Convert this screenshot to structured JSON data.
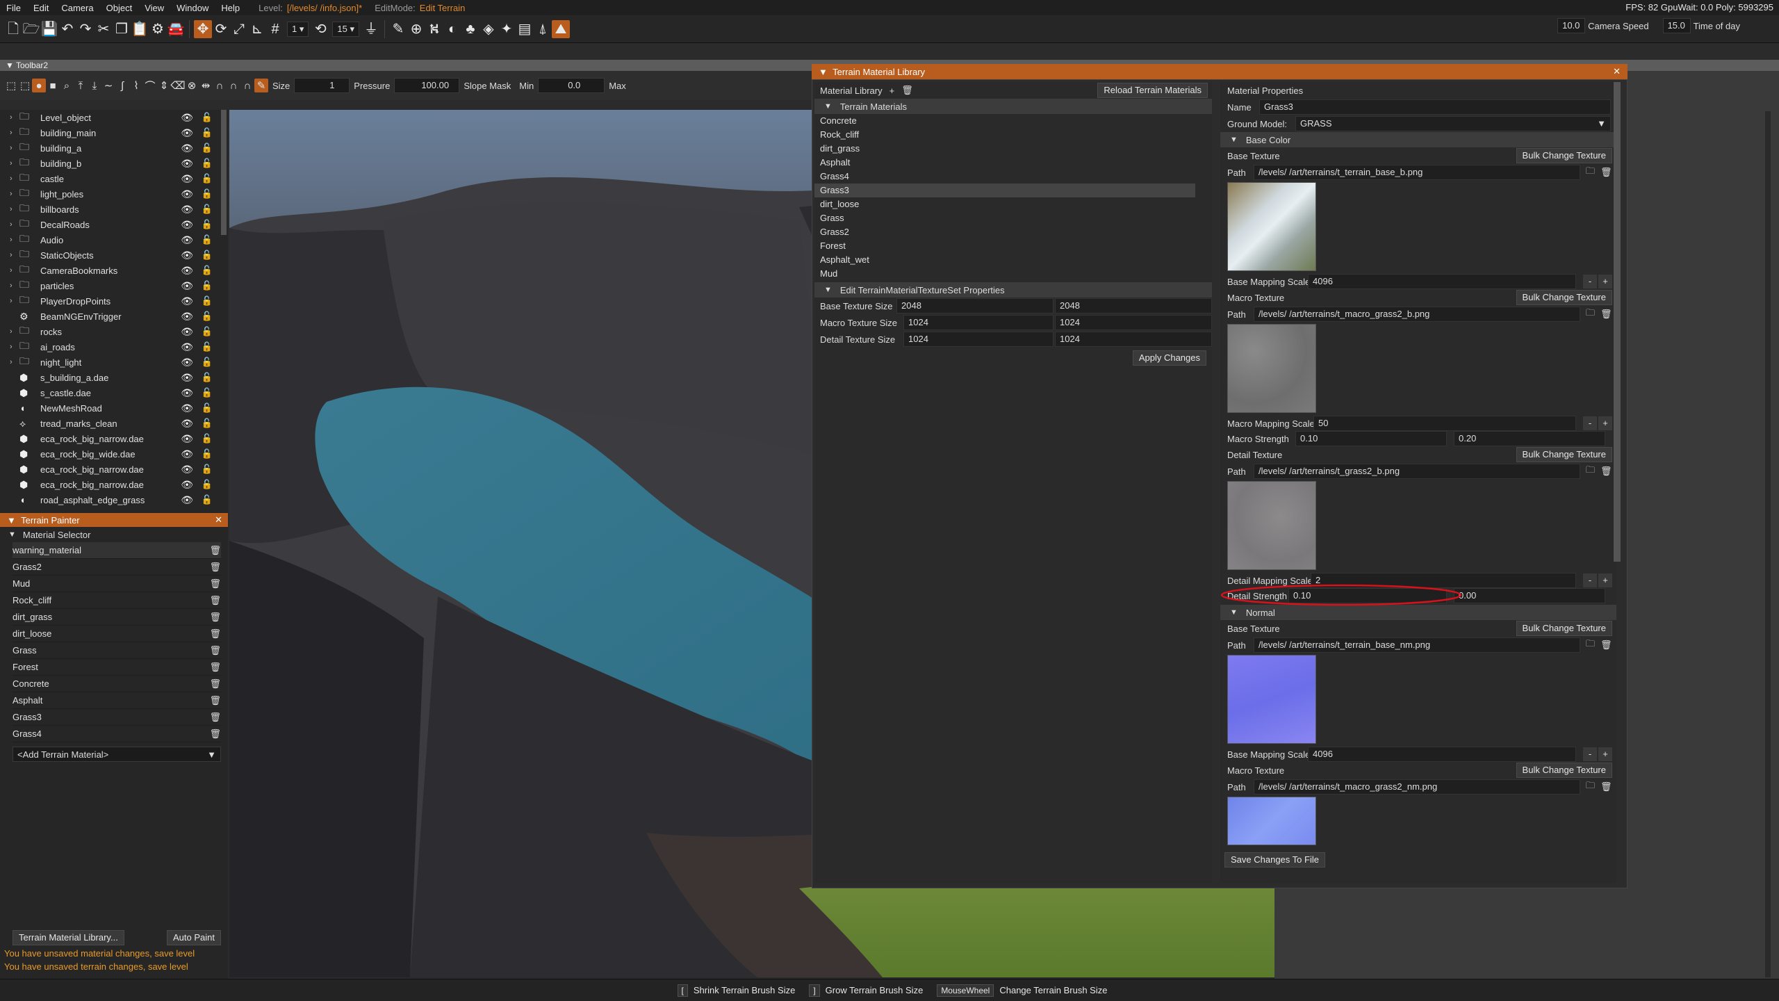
{
  "menu": {
    "items": [
      "File",
      "Edit",
      "Camera",
      "Object",
      "View",
      "Window",
      "Help"
    ],
    "level_label": "Level:",
    "level_value": "[/levels/          /info.json]*",
    "editmode_label": "EditMode:",
    "editmode_value": "Edit Terrain",
    "perf": "FPS: 82  GpuWait: 0.0  Poly: 5993295"
  },
  "toolbar": {
    "snap_value": "1",
    "rotate_snap_value": "15"
  },
  "camera": {
    "speed_value": "10.0",
    "speed_label": "Camera Speed",
    "time_value": "15.0",
    "time_label": "Time of day"
  },
  "toolbar2": {
    "title": "Toolbar2",
    "size_label": "Size",
    "size_value": "1",
    "pressure_label": "Pressure",
    "pressure_value": "100.00",
    "slope_label": "Slope Mask",
    "min_label": "Min",
    "min_value": "0.0",
    "max_label": "Max"
  },
  "scene_tree": [
    {
      "label": "Level_object",
      "icon": "folder"
    },
    {
      "label": "building_main",
      "icon": "folder"
    },
    {
      "label": "building_a",
      "icon": "folder"
    },
    {
      "label": "building_b",
      "icon": "folder"
    },
    {
      "label": "castle",
      "icon": "folder"
    },
    {
      "label": "light_poles",
      "icon": "folder"
    },
    {
      "label": "billboards",
      "icon": "folder"
    },
    {
      "label": "DecalRoads",
      "icon": "folder"
    },
    {
      "label": "Audio",
      "icon": "folder"
    },
    {
      "label": "StaticObjects",
      "icon": "folder"
    },
    {
      "label": "CameraBookmarks",
      "icon": "folder"
    },
    {
      "label": "particles",
      "icon": "folder"
    },
    {
      "label": "PlayerDropPoints",
      "icon": "folder"
    },
    {
      "label": "BeamNGEnvTrigger",
      "icon": "trigger"
    },
    {
      "label": "rocks",
      "icon": "folder"
    },
    {
      "label": "ai_roads",
      "icon": "folder"
    },
    {
      "label": "night_light",
      "icon": "folder"
    },
    {
      "label": "s_building_a.dae",
      "icon": "mesh"
    },
    {
      "label": "s_castle.dae",
      "icon": "mesh"
    },
    {
      "label": "NewMeshRoad",
      "icon": "road"
    },
    {
      "label": "tread_marks_clean",
      "icon": "decal"
    },
    {
      "label": "eca_rock_big_narrow.dae",
      "icon": "mesh"
    },
    {
      "label": "eca_rock_big_wide.dae",
      "icon": "mesh"
    },
    {
      "label": "eca_rock_big_narrow.dae",
      "icon": "mesh"
    },
    {
      "label": "eca_rock_big_narrow.dae",
      "icon": "mesh"
    },
    {
      "label": "road_asphalt_edge_grass",
      "icon": "road"
    }
  ],
  "terrain_painter": {
    "title": "Terrain Painter",
    "section": "Material Selector",
    "materials": [
      "warning_material",
      "Grass2",
      "Mud",
      "Rock_cliff",
      "dirt_grass",
      "dirt_loose",
      "Grass",
      "Forest",
      "Concrete",
      "Asphalt",
      "Grass3",
      "Grass4"
    ],
    "add_material": "<Add Terrain Material>",
    "library_button": "Terrain Material Library...",
    "auto_paint": "Auto Paint",
    "warn_material": "You have unsaved material changes, save level",
    "warn_terrain": "You have unsaved terrain changes, save level"
  },
  "library": {
    "title": "Terrain Material Library",
    "material_library_label": "Material Library",
    "reload_button": "Reload Terrain Materials",
    "terrain_materials_header": "Terrain Materials",
    "materials": [
      "Concrete",
      "Rock_cliff",
      "dirt_grass",
      "Asphalt",
      "Grass4",
      "Grass3",
      "dirt_loose",
      "Grass",
      "Grass2",
      "Forest",
      "Asphalt_wet",
      "Mud"
    ],
    "selected": "Grass3",
    "texset_header": "Edit TerrainMaterialTextureSet Properties",
    "base_size_label": "Base Texture Size",
    "base_size_a": "2048",
    "base_size_b": "2048",
    "macro_size_label": "Macro Texture Size",
    "macro_size_a": "1024",
    "macro_size_b": "1024",
    "detail_size_label": "Detail Texture Size",
    "detail_size_a": "1024",
    "detail_size_b": "1024",
    "apply_button": "Apply Changes"
  },
  "props": {
    "header": "Material Properties",
    "name_label": "Name",
    "name_value": "Grass3",
    "ground_label": "Ground Model:",
    "ground_value": "GRASS",
    "base_color_header": "Base Color",
    "base_texture_label": "Base Texture",
    "bulk_label": "Bulk Change Texture",
    "path_label": "Path",
    "bc_base_path": "/levels/           /art/terrains/t_terrain_base_b.png",
    "base_mapping_label": "Base Mapping Scale",
    "bc_base_mapping": "4096",
    "macro_texture_label": "Macro Texture",
    "bc_macro_path": "/levels/           /art/terrains/t_macro_grass2_b.png",
    "macro_mapping_label": "Macro Mapping Scale",
    "bc_macro_mapping": "50",
    "macro_strength_label": "Macro Strength",
    "bc_macro_strength_a": "0.10",
    "bc_macro_strength_b": "0.20",
    "detail_texture_label": "Detail Texture",
    "bc_detail_path": "/levels/           /art/terrains/t_grass2_b.png",
    "detail_mapping_label": "Detail Mapping Scale",
    "bc_detail_mapping": "2",
    "detail_strength_label": "Detail Strength",
    "bc_detail_strength_a": "0.10",
    "bc_detail_strength_b": "0.00",
    "normal_header": "Normal",
    "n_base_path": "/levels/           /art/terrains/t_terrain_base_nm.png",
    "n_base_mapping": "4096",
    "n_macro_path": "/levels/           /art/terrains/t_macro_grass2_nm.png",
    "save_button": "Save Changes To File",
    "minus": "-",
    "plus": "+"
  },
  "status": {
    "shrink_key": "[",
    "shrink_label": "Shrink Terrain Brush Size",
    "grow_key": "]",
    "grow_label": "Grow Terrain Brush Size",
    "wheel_key": "MouseWheel",
    "wheel_label": "Change Terrain Brush Size"
  },
  "colors": {
    "accent": "#b85d1d",
    "warning_text": "#e89a2a",
    "highlight_ellipse": "#d8121a"
  }
}
